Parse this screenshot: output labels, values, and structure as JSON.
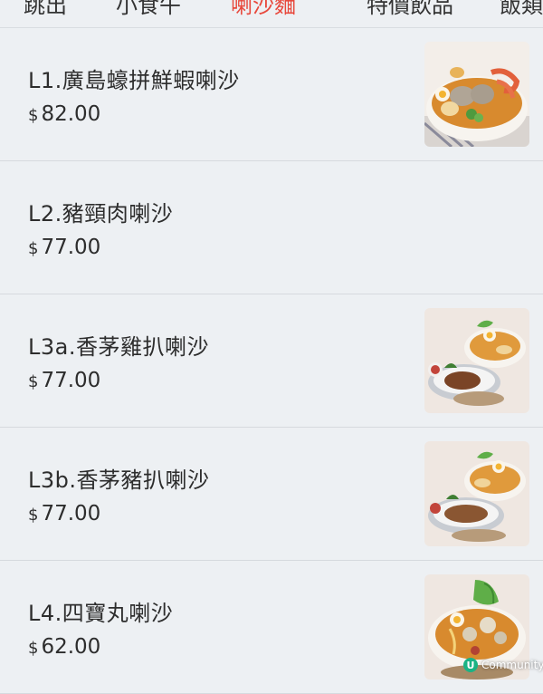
{
  "tabs": [
    {
      "label": "跳出"
    },
    {
      "label": "小食午"
    },
    {
      "label": "喇沙麵"
    },
    {
      "label": "特價飲品"
    },
    {
      "label": "飯類"
    }
  ],
  "currency_symbol": "$",
  "items": [
    {
      "name": "L1.廣島蠔拼鮮蝦喇沙",
      "price": "82.00",
      "has_image": true
    },
    {
      "name": "L2.豬頸肉喇沙",
      "price": "77.00",
      "has_image": false
    },
    {
      "name": "L3a.香茅雞扒喇沙",
      "price": "77.00",
      "has_image": true
    },
    {
      "name": "L3b.香茅豬扒喇沙",
      "price": "77.00",
      "has_image": true
    },
    {
      "name": "L4.四寶丸喇沙",
      "price": "62.00",
      "has_image": true
    }
  ],
  "watermark": {
    "badge": "U",
    "text": "Community"
  },
  "colors": {
    "background": "#edf0f3",
    "active_tab": "#e8483c",
    "divider": "#d6dade"
  }
}
